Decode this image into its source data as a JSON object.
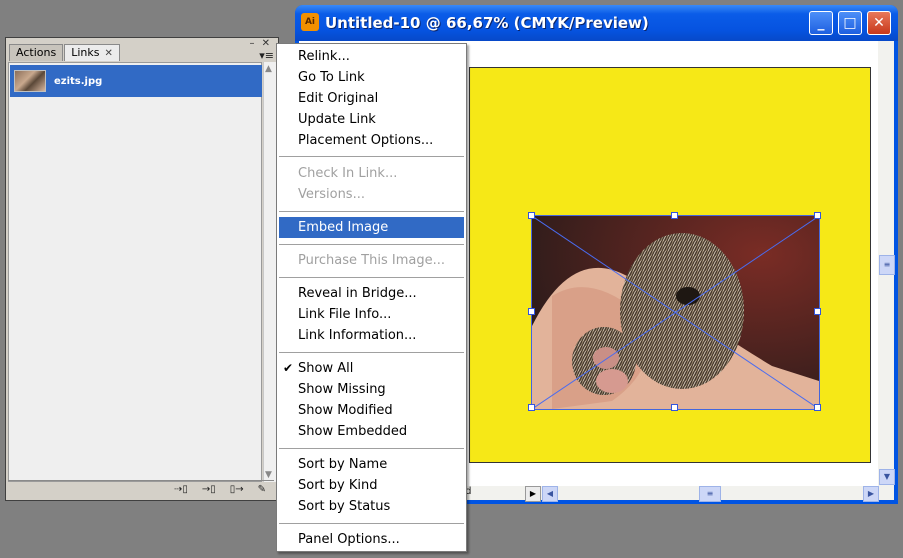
{
  "panel": {
    "tabs": [
      {
        "label": "Actions"
      },
      {
        "label": "Links",
        "close": "✕"
      }
    ],
    "top_buttons": "– ✕",
    "menu_button": "▾≡",
    "items": [
      {
        "filename": "ezits.jpg"
      }
    ],
    "footer_buttons": [
      "⇢▯",
      "→▯",
      "▯→",
      "✎"
    ]
  },
  "window": {
    "title": "Untitled-10 @ 66,67% (CMYK/Preview)",
    "icon_text": "Ai",
    "buttons": {
      "min": "_",
      "max": "□",
      "close": "✕"
    },
    "status_fragment": "ed",
    "artboard_color": "#f6e817"
  },
  "menu": {
    "items": [
      {
        "label": "Relink...",
        "enabled": true
      },
      {
        "label": "Go To Link",
        "enabled": true
      },
      {
        "label": "Edit Original",
        "enabled": true
      },
      {
        "label": "Update Link",
        "enabled": true
      },
      {
        "label": "Placement Options...",
        "enabled": true
      },
      {
        "label": "Check In Link...",
        "enabled": false
      },
      {
        "label": "Versions...",
        "enabled": false
      },
      {
        "label": "Embed Image",
        "enabled": true,
        "highlighted": true
      },
      {
        "label": "Purchase This Image...",
        "enabled": false
      },
      {
        "label": "Reveal in Bridge...",
        "enabled": true
      },
      {
        "label": "Link File Info...",
        "enabled": true
      },
      {
        "label": "Link Information...",
        "enabled": true
      },
      {
        "label": "Show All",
        "enabled": true,
        "checked": true
      },
      {
        "label": "Show Missing",
        "enabled": true
      },
      {
        "label": "Show Modified",
        "enabled": true
      },
      {
        "label": "Show Embedded",
        "enabled": true
      },
      {
        "label": "Sort by Name",
        "enabled": true
      },
      {
        "label": "Sort by Kind",
        "enabled": true
      },
      {
        "label": "Sort by Status",
        "enabled": true
      },
      {
        "label": "Panel Options...",
        "enabled": true
      }
    ]
  }
}
